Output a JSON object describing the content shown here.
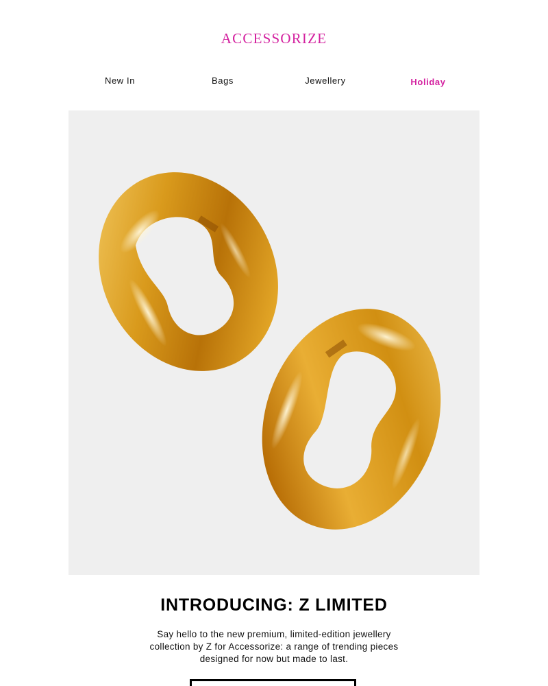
{
  "brand": {
    "logo_text": "ACCESSORIZE",
    "accent_color": "#d3209f"
  },
  "nav": {
    "items": [
      {
        "label": "New In"
      },
      {
        "label": "Bags"
      },
      {
        "label": "Jewellery"
      },
      {
        "label": "Holiday"
      }
    ]
  },
  "hero": {
    "image_subject": "gold-earrings",
    "background_color": "#efefef"
  },
  "headline": "INTRODUCING: Z LIMITED",
  "body_text": "Say hello to the new premium, limited-edition jewellery collection by Z for Accessorize: a range of trending pieces designed for now but made to last.",
  "cta": {
    "label": ""
  }
}
